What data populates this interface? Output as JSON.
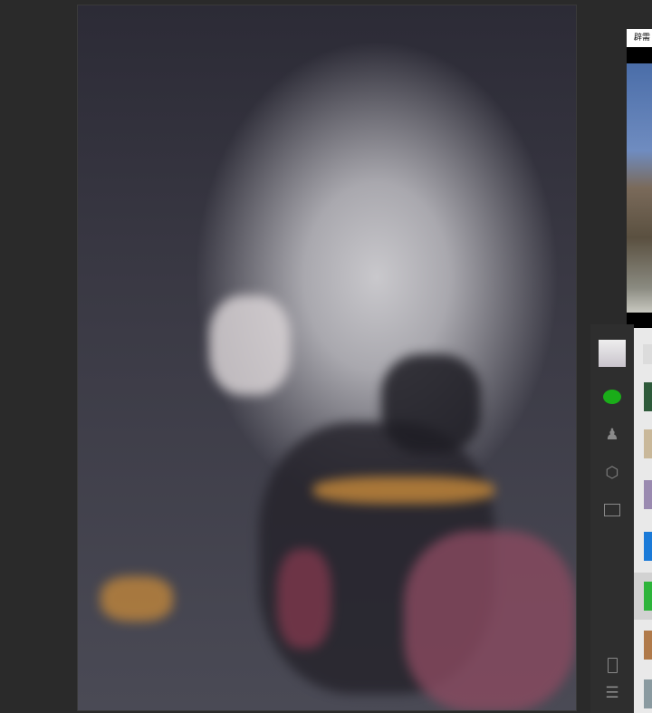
{
  "window": {
    "background_color": "#2a2a2a"
  },
  "artwork": {
    "subject": "painting",
    "accent_colors": [
      "#c9c8cc",
      "#2c2b36",
      "#c88a3a",
      "#8a4a60"
    ]
  },
  "photo_preview": {
    "title": "辟需"
  },
  "sidebar": {
    "items": [
      {
        "name": "avatar"
      },
      {
        "name": "chat-icon",
        "color": "#1aad19"
      },
      {
        "name": "contacts-icon"
      },
      {
        "name": "favorites-icon"
      },
      {
        "name": "files-icon"
      },
      {
        "name": "phone-icon"
      },
      {
        "name": "menu-icon"
      }
    ]
  }
}
